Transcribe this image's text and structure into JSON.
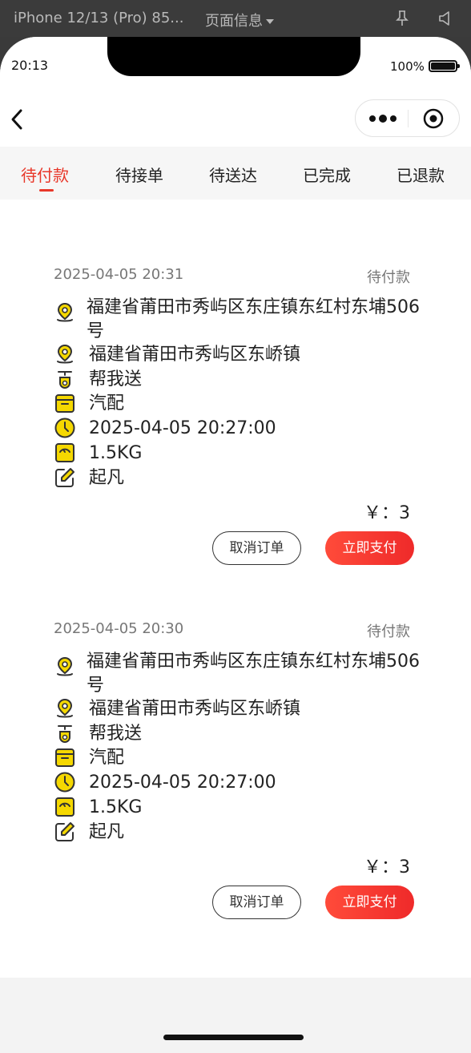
{
  "devtools": {
    "device_label": "iPhone 12/13 (Pro) 85...",
    "page_info_label": "页面信息"
  },
  "status_bar": {
    "time": "20:13",
    "battery": "100%"
  },
  "tabs": [
    {
      "label": "待付款",
      "active": true
    },
    {
      "label": "待接单",
      "active": false
    },
    {
      "label": "待送达",
      "active": false
    },
    {
      "label": "已完成",
      "active": false
    },
    {
      "label": "已退款",
      "active": false
    }
  ],
  "orders": [
    {
      "created_time": "2025-04-05 20:31",
      "status": "待付款",
      "from_address": "福建省莆田市秀屿区东庄镇东红村东埔506号",
      "to_address": "福建省莆田市秀屿区东峤镇",
      "service": "帮我送",
      "goods": "汽配",
      "pickup_time": "2025-04-05 20:27:00",
      "weight": "1.5KG",
      "note": "起凡",
      "price": "￥：3",
      "cancel_label": "取消订单",
      "pay_label": "立即支付"
    },
    {
      "created_time": "2025-04-05 20:30",
      "status": "待付款",
      "from_address": "福建省莆田市秀屿区东庄镇东红村东埔506号",
      "to_address": "福建省莆田市秀屿区东峤镇",
      "service": "帮我送",
      "goods": "汽配",
      "pickup_time": "2025-04-05 20:27:00",
      "weight": "1.5KG",
      "note": "起凡",
      "price": "￥：3",
      "cancel_label": "取消订单",
      "pay_label": "立即支付"
    }
  ],
  "colors": {
    "accent": "#e8382a",
    "icon_yellow": "#f5d800",
    "pay_button": "#f33a2f"
  },
  "icons": [
    "back-icon",
    "more-dots-icon",
    "close-target-icon",
    "location-pin-icon",
    "scooter-icon",
    "box-icon",
    "clock-icon",
    "scale-icon",
    "edit-icon",
    "pin-icon",
    "mute-icon"
  ]
}
